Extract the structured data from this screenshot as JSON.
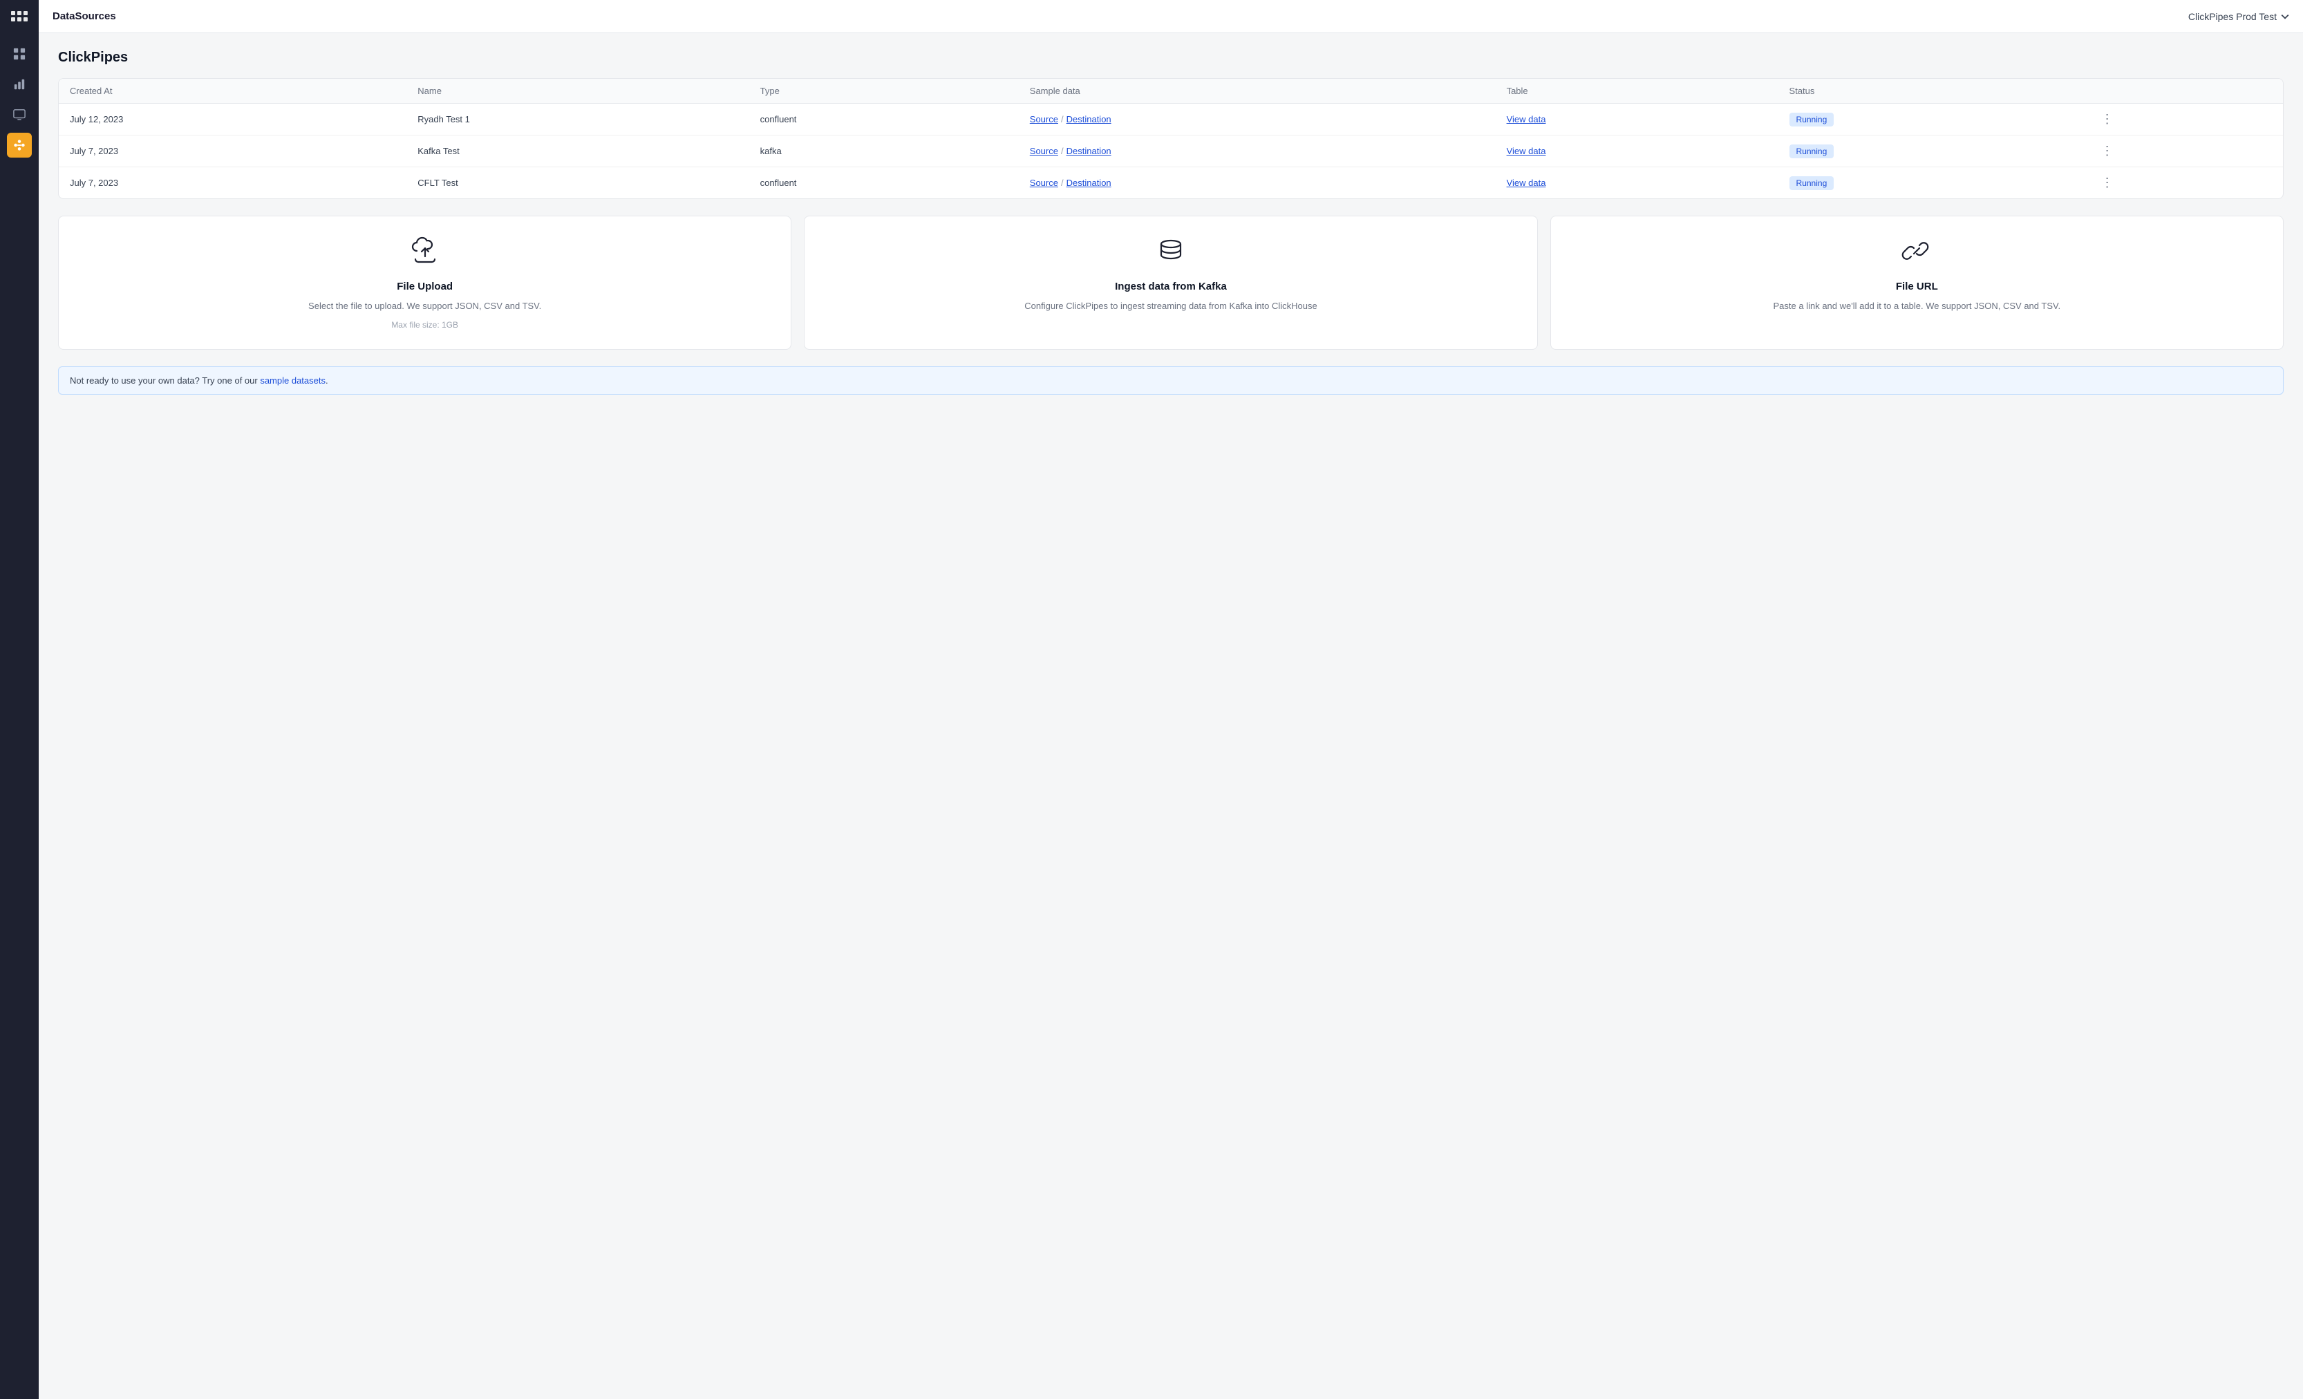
{
  "app": {
    "title": "DataSources",
    "env_label": "ClickPipes Prod Test",
    "env_chevron": "▾"
  },
  "page": {
    "title": "ClickPipes"
  },
  "sidebar": {
    "icons": [
      {
        "name": "grid-icon",
        "glyph": "⊞",
        "active": false
      },
      {
        "name": "chart-icon",
        "glyph": "📊",
        "active": false
      },
      {
        "name": "monitor-icon",
        "glyph": "🖥",
        "active": false
      },
      {
        "name": "pipes-icon",
        "glyph": "⚡",
        "active": true
      }
    ]
  },
  "table": {
    "columns": [
      "Created At",
      "Name",
      "Type",
      "Sample data",
      "Table",
      "Status"
    ],
    "rows": [
      {
        "created_at": "July 12, 2023",
        "name": "Ryadh Test 1",
        "type": "confluent",
        "source_label": "Source",
        "destination_label": "Destination",
        "view_data_label": "View data",
        "status": "Running"
      },
      {
        "created_at": "July 7, 2023",
        "name": "Kafka Test",
        "type": "kafka",
        "source_label": "Source",
        "destination_label": "Destination",
        "view_data_label": "View data",
        "status": "Running"
      },
      {
        "created_at": "July 7, 2023",
        "name": "CFLT Test",
        "type": "confluent",
        "source_label": "Source",
        "destination_label": "Destination",
        "view_data_label": "View data",
        "status": "Running"
      }
    ]
  },
  "cards": [
    {
      "id": "file-upload",
      "title": "File Upload",
      "desc": "Select the file to upload. We support JSON, CSV and TSV.",
      "sub": "Max file size: 1GB",
      "icon_type": "upload"
    },
    {
      "id": "kafka",
      "title": "Ingest data from Kafka",
      "desc": "Configure ClickPipes to ingest streaming data from Kafka into ClickHouse",
      "sub": "",
      "icon_type": "database"
    },
    {
      "id": "file-url",
      "title": "File URL",
      "desc": "Paste a link and we'll add it to a table. We support JSON, CSV and TSV.",
      "sub": "",
      "icon_type": "link"
    }
  ],
  "info_bar": {
    "text_before": "Not ready to use your own data? Try one of our ",
    "link_text": "sample datasets",
    "text_after": "."
  }
}
